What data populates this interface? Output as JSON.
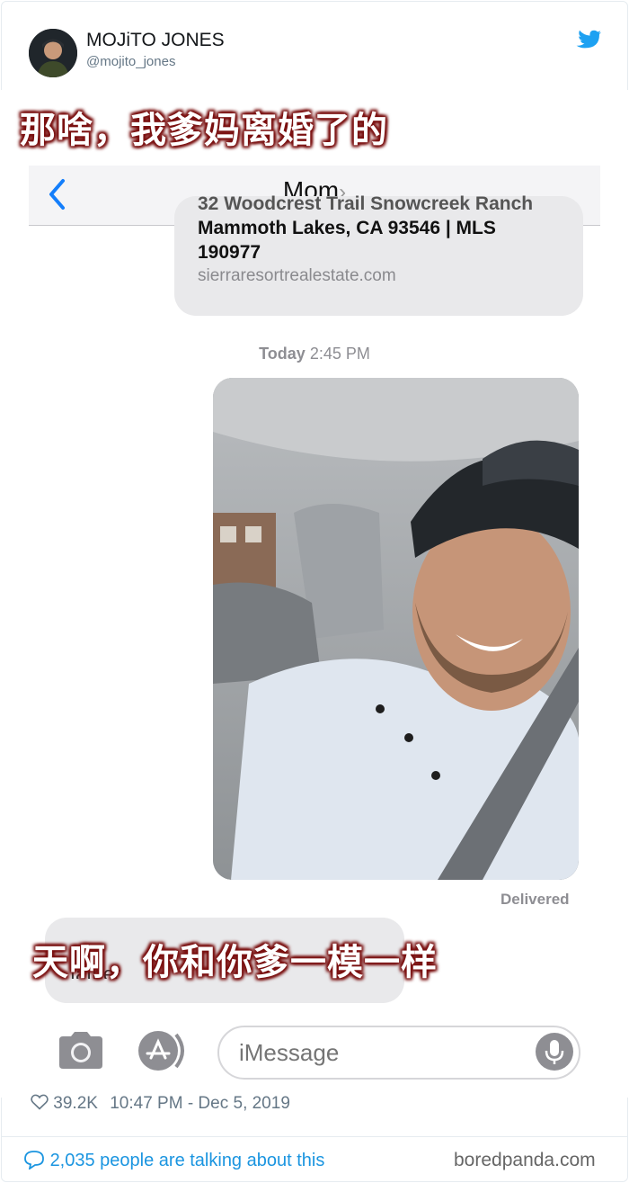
{
  "tweet": {
    "display_name": "MOJiTO JONES",
    "handle": "@mojito_jones",
    "likes": "39.2K",
    "timestamp": "10:47 PM - Dec 5, 2019",
    "talking": "2,035 people are talking about this"
  },
  "captions": {
    "top": "那啥，我爹妈离婚了的",
    "bottom": "天啊，你和你爹一模一样"
  },
  "messages": {
    "contact": "Mom",
    "bubble_lines": [
      "32 Woodcrest Trail Snowcreek Ranch",
      "Mammoth Lakes, CA 93546 | MLS",
      "190977"
    ],
    "link": "sierraresortrealestate.com",
    "time_day": "Today",
    "time_clock": "2:45 PM",
    "status": "Delivered",
    "reply_fragment": "father",
    "input_placeholder": "iMessage"
  },
  "watermark": "boredpanda.com",
  "colors": {
    "twitter_blue": "#1da1f2",
    "ios_blue": "#147efb",
    "caption_glow": "#7a1010"
  }
}
